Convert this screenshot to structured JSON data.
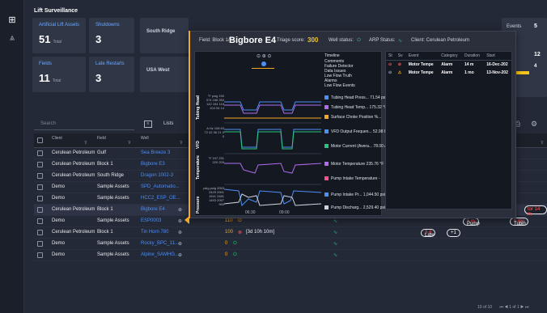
{
  "app": {
    "title": "Lift Surveillance"
  },
  "kpis": [
    {
      "label": "Artificial Lift Assets",
      "value": "51",
      "unit": "Total"
    },
    {
      "label": "Shutdowns",
      "value": "3",
      "unit": ""
    },
    {
      "label": "Fields",
      "value": "11",
      "unit": "Total"
    },
    {
      "label": "Late Restarts",
      "value": "3",
      "unit": ""
    }
  ],
  "fields": {
    "south_ridge": "South Ridge",
    "usa_west": "USA West"
  },
  "events_card": {
    "title": "Events",
    "count": "5",
    "second": "12",
    "third": "4"
  },
  "toolbar": {
    "search_placeholder": "Search",
    "lists_label": "Lists"
  },
  "grid": {
    "columns": [
      "Client",
      "Field",
      "Well"
    ],
    "rows": [
      {
        "client": "Cerulean Petroleum",
        "field": "Gulf",
        "well": "Sea Breeze 3",
        "score": "",
        "status": "",
        "right": ""
      },
      {
        "client": "Cerulean Petroleum",
        "field": "Block 1",
        "well": "Bigbore E3",
        "score": "",
        "status": "",
        "right": ""
      },
      {
        "client": "Cerulean Petroleum",
        "field": "South Ridge",
        "well": "Dragon 1002-3",
        "score": "",
        "status": "",
        "right": ""
      },
      {
        "client": "Demo",
        "field": "Sample Assets",
        "well": "SPD_Automatio...",
        "score": "",
        "status": "",
        "right": ""
      },
      {
        "client": "Demo",
        "field": "Sample Assets",
        "well": "HCC2_ESP_OE...",
        "score": "",
        "status": "",
        "right": ""
      },
      {
        "client": "Cerulean Petroleum",
        "field": "Block 1",
        "well": "Bigbore E4",
        "score": "",
        "status": "",
        "right": "tor 14 m"
      },
      {
        "client": "Demo",
        "field": "Sample Assets",
        "well": "ESP0003",
        "score": "110",
        "status": "",
        "right": ""
      },
      {
        "client": "Cerulean Petroleum",
        "field": "Block 1",
        "well": "Tin Horn 780",
        "score": "100",
        "status": "[3d 10h 10m]",
        "right": ""
      },
      {
        "client": "Demo",
        "field": "Sample Assets",
        "well": "Rocky_BPC_11...",
        "score": "0",
        "status": "",
        "right": ""
      },
      {
        "client": "Demo",
        "field": "Sample Assets",
        "well": "Alpine_SAMHG...",
        "score": "0",
        "status": "",
        "right": ""
      }
    ],
    "pills": {
      "pump": "Pump",
      "pump_time": "5 m",
      "tubin": "Tubin",
      "tubin_time": "1 mo",
      "late": "Late",
      "late_time": "3 d",
      "plus": "+1"
    }
  },
  "footer": {
    "range": "10 of 10",
    "page": "1 of 1"
  },
  "overlay": {
    "field_label": "Field: Block 1/",
    "well": "Bigbore E4",
    "triage_label": "Triage score:",
    "triage_score": "300",
    "well_status_label": "Well status:",
    "arp_label": "ARP Status:",
    "client_label": "Client: Cerulean Petroleum",
    "timeline_items": [
      "Timeline",
      "Comments",
      "Failure Detector",
      "Data Issues",
      "Low Flow Truth",
      "Alarms",
      "Low Flow Events"
    ],
    "tubing_legend": [
      {
        "label": "Tubing Head Press... 71.54 psig",
        "color": "#4d8ef7"
      },
      {
        "label": "Tubing Head Temp... 175.32 °F",
        "color": "#b06cf0"
      },
      {
        "label": "Surface Choke Position %...",
        "color": "#f5a623"
      }
    ],
    "vfd_legend": [
      {
        "label": "VFD Output Frequen... 52.98 Hz",
        "color": "#4d8ef7"
      },
      {
        "label": "Motor Current (Avera... 78.00 A",
        "color": "#29c480"
      }
    ],
    "temp_legend": [
      {
        "label": "Motor Temperature 235.76 °F",
        "color": "#b06cf0"
      },
      {
        "label": "Pump Intake Temperature -",
        "color": "#ff4f8b"
      }
    ],
    "press_legend": [
      {
        "label": "Pump Intake Pr... 1,044.50 psig",
        "color": "#4d8ef7"
      },
      {
        "label": "Pump Discharg... 2,529.40 psig",
        "color": "#cfd5df"
      }
    ],
    "section_labels": {
      "tubing": "Tubing Head",
      "vfd": "VFD",
      "temp": "Temperature",
      "press": "Pressure"
    },
    "times": {
      "t1": "06:30",
      "t2": "09:00"
    },
    "events_table": {
      "headers": [
        "St",
        "Sv",
        "Event",
        "Category",
        "Duration",
        "Start"
      ],
      "rows": [
        {
          "event": "Motor Tempe",
          "category": "Alarm",
          "duration": "14 m",
          "start": "16-Dec-202"
        },
        {
          "event": "Motor Tempe",
          "category": "Alarm",
          "duration": "1 mo",
          "start": "13-Nov-202"
        }
      ]
    },
    "ticks": {
      "tubing": "°F psig 190 374 166 284 142 194 118 104 94 14",
      "vfd": "A Hz 108 63 72 42 36 21 0 0",
      "temp": "°F 247 231 220 209",
      "press": "psig psig 3353 2429 2901 1941 2481 1453 2057 965"
    }
  }
}
